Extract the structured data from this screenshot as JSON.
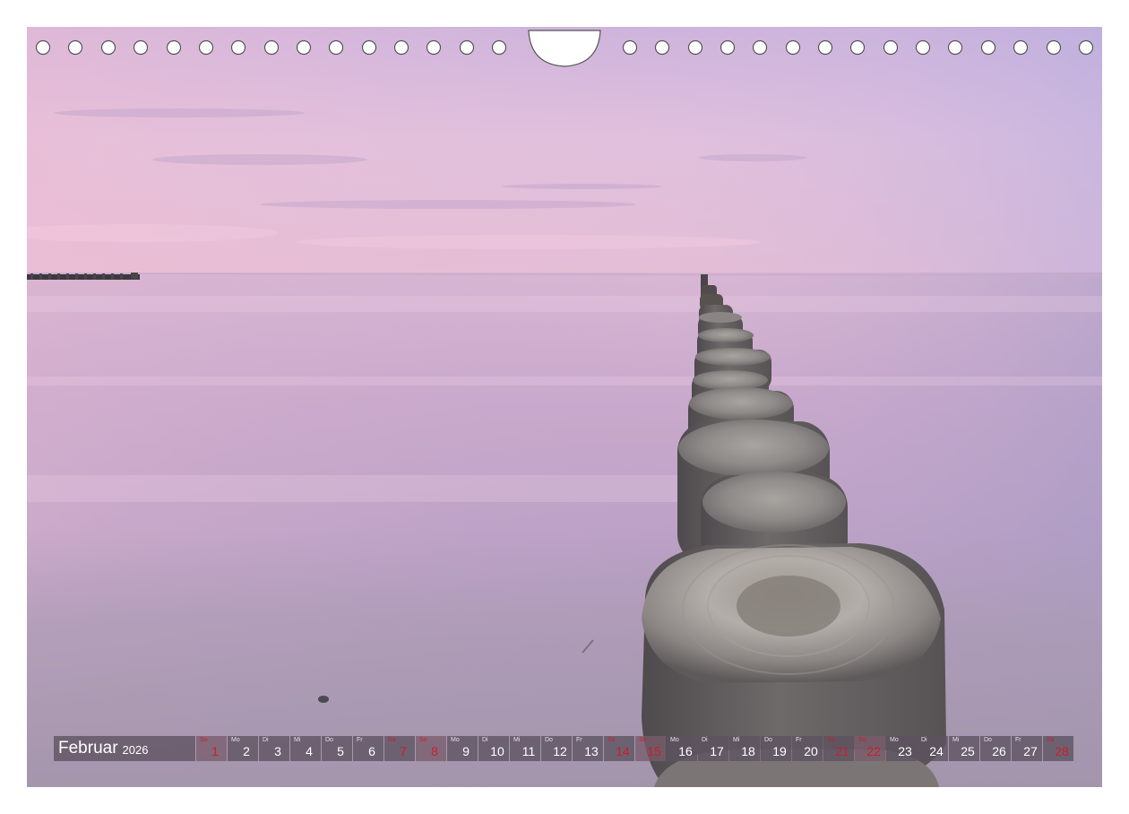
{
  "calendar": {
    "month": "Februar",
    "year": "2026",
    "days": [
      {
        "dow": "So",
        "num": "1",
        "holiday": true
      },
      {
        "dow": "Mo",
        "num": "2",
        "holiday": false
      },
      {
        "dow": "Di",
        "num": "3",
        "holiday": false
      },
      {
        "dow": "Mi",
        "num": "4",
        "holiday": false
      },
      {
        "dow": "Do",
        "num": "5",
        "holiday": false
      },
      {
        "dow": "Fr",
        "num": "6",
        "holiday": false
      },
      {
        "dow": "Sa",
        "num": "7",
        "holiday": true
      },
      {
        "dow": "So",
        "num": "8",
        "holiday": true
      },
      {
        "dow": "Mo",
        "num": "9",
        "holiday": false
      },
      {
        "dow": "Di",
        "num": "10",
        "holiday": false
      },
      {
        "dow": "Mi",
        "num": "11",
        "holiday": false
      },
      {
        "dow": "Do",
        "num": "12",
        "holiday": false
      },
      {
        "dow": "Fr",
        "num": "13",
        "holiday": false
      },
      {
        "dow": "Sa",
        "num": "14",
        "holiday": true
      },
      {
        "dow": "So",
        "num": "15",
        "holiday": true
      },
      {
        "dow": "Mo",
        "num": "16",
        "holiday": false
      },
      {
        "dow": "Di",
        "num": "17",
        "holiday": false
      },
      {
        "dow": "Mi",
        "num": "18",
        "holiday": false
      },
      {
        "dow": "Do",
        "num": "19",
        "holiday": false
      },
      {
        "dow": "Fr",
        "num": "20",
        "holiday": false
      },
      {
        "dow": "Sa",
        "num": "21",
        "holiday": true
      },
      {
        "dow": "So",
        "num": "22",
        "holiday": true
      },
      {
        "dow": "Mo",
        "num": "23",
        "holiday": false
      },
      {
        "dow": "Di",
        "num": "24",
        "holiday": false
      },
      {
        "dow": "Mi",
        "num": "25",
        "holiday": false
      },
      {
        "dow": "Do",
        "num": "26",
        "holiday": false
      },
      {
        "dow": "Fr",
        "num": "27",
        "holiday": false
      },
      {
        "dow": "Sa",
        "num": "28",
        "holiday": true
      }
    ]
  },
  "colors": {
    "sky_top": "#c3a9d8",
    "sky_pink": "#e6b8d2",
    "sea": "#b99fc4",
    "sand": "#aa9ab2",
    "holiday": "#cc1d2c",
    "strip": "#5c5260"
  },
  "photo": {
    "subject": "groyne-posts-sea-dusk"
  }
}
